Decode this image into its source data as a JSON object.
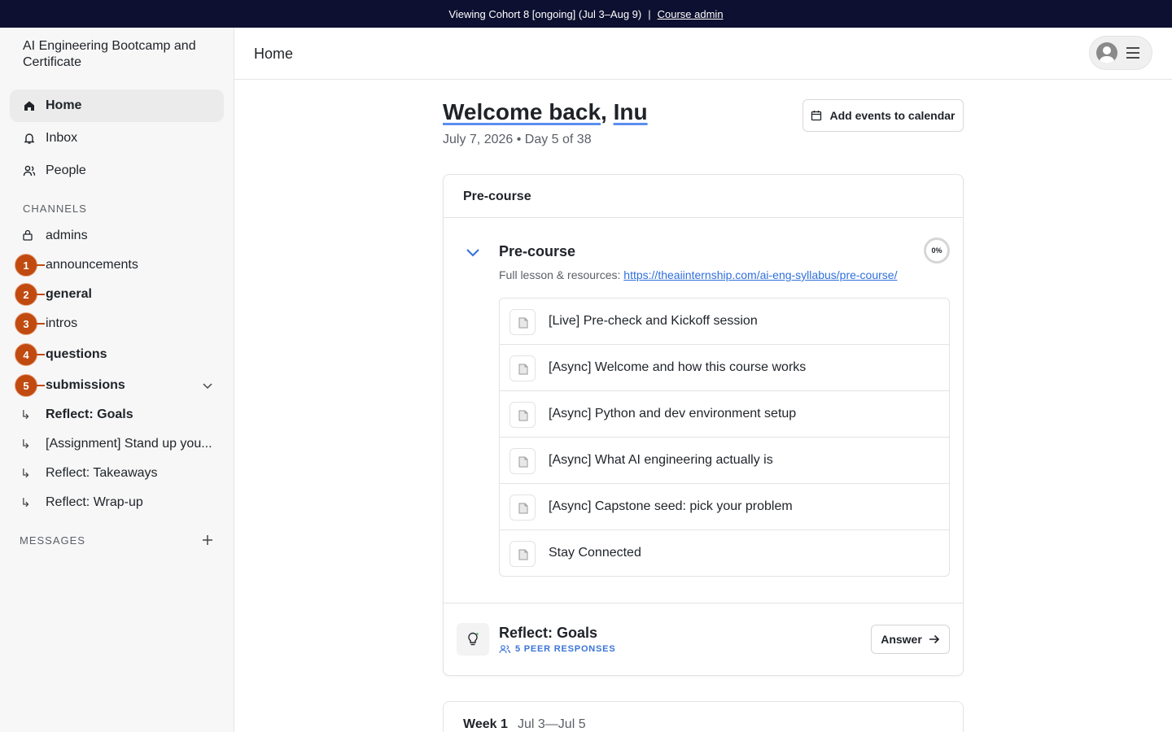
{
  "topbar": {
    "cohort_text": "Viewing Cohort 8 [ongoing] (Jul 3–Aug 9)",
    "separator": "|",
    "admin_link": "Course admin"
  },
  "sidebar": {
    "app_title": "AI Engineering Bootcamp and Certificate",
    "nav": [
      {
        "label": "Home",
        "icon": "home-icon",
        "active": true
      },
      {
        "label": "Inbox",
        "icon": "bell-icon"
      },
      {
        "label": "People",
        "icon": "people-icon"
      }
    ],
    "channels_label": "CHANNELS",
    "channels": [
      {
        "label": "admins",
        "icon": "lock-icon"
      },
      {
        "label": "announcements",
        "badge": "1"
      },
      {
        "label": "general",
        "badge": "2"
      },
      {
        "label": "intros",
        "badge": "3"
      },
      {
        "label": "questions",
        "badge": "4"
      },
      {
        "label": "submissions",
        "badge": "5"
      }
    ],
    "sub_items": [
      {
        "label": "Reflect: Goals"
      },
      {
        "label": "[Assignment] Stand up you..."
      },
      {
        "label": "Reflect: Takeaways"
      },
      {
        "label": "Reflect: Wrap-up"
      }
    ],
    "messages_label": "MESSAGES",
    "sub_arrow": "↳"
  },
  "header": {
    "title": "Home"
  },
  "main": {
    "welcome_prefix": "Welcome back",
    "welcome_comma": ",",
    "welcome_name": "Inu",
    "date_line": "July 7, 2026 • Day 5 of 38",
    "calendar_button": "Add events to calendar",
    "card": {
      "header": "Pre-course",
      "module_title": "Pre-course",
      "progress": "0%",
      "resources_label": "Full lesson & resources: ",
      "resources_link": "https://theaiinternship.com/ai-eng-syllabus/pre-course/",
      "lessons": [
        "[Live] Pre-check and Kickoff session",
        "[Async] Welcome and how this course works",
        "[Async] Python and dev environment setup",
        "[Async] What AI engineering actually is",
        "[Async] Capstone seed: pick your problem",
        "Stay Connected"
      ],
      "reflect_title": "Reflect: Goals",
      "peer_responses": "5 PEER RESPONSES",
      "answer_button": "Answer"
    },
    "week_card": {
      "title": "Week 1",
      "dates": "Jul 3—Jul 5"
    }
  },
  "colors": {
    "topbar_bg": "#0d1030",
    "badge": "#c04a10",
    "link": "#2f6fdd",
    "underline": "#5b8ef0"
  }
}
